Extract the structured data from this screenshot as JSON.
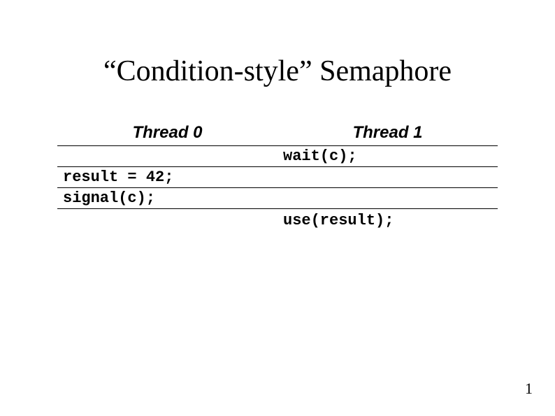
{
  "title": "“Condition-style” Semaphore",
  "columns": {
    "left": "Thread 0",
    "right": "Thread 1"
  },
  "rows": {
    "r1": {
      "left": "",
      "right": "wait(c);"
    },
    "r2": {
      "left": "result = 42;",
      "right": ""
    },
    "r3": {
      "left": "signal(c);",
      "right": ""
    },
    "r4": {
      "left": "",
      "right": "use(result);"
    }
  },
  "page_number": "1"
}
